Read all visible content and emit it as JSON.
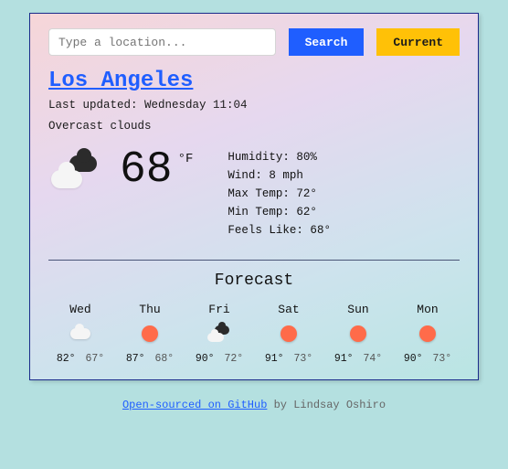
{
  "search": {
    "placeholder": "Type a location...",
    "search_label": "Search",
    "current_label": "Current"
  },
  "location": {
    "name": "Los Angeles",
    "last_updated": "Last updated: Wednesday 11:04",
    "condition": "Overcast clouds"
  },
  "current": {
    "temp": "68",
    "unit": "°F",
    "humidity": "Humidity: 80%",
    "wind": "Wind: 8 mph",
    "max": "Max Temp: 72°",
    "min": "Min Temp: 62°",
    "feels": "Feels Like: 68°",
    "icon": "overcast"
  },
  "forecast": {
    "title": "Forecast",
    "days": [
      {
        "name": "Wed",
        "icon": "cloud",
        "hi": "82°",
        "lo": "67°"
      },
      {
        "name": "Thu",
        "icon": "sun",
        "hi": "87°",
        "lo": "68°"
      },
      {
        "name": "Fri",
        "icon": "mix",
        "hi": "90°",
        "lo": "72°"
      },
      {
        "name": "Sat",
        "icon": "sun",
        "hi": "91°",
        "lo": "73°"
      },
      {
        "name": "Sun",
        "icon": "sun",
        "hi": "91°",
        "lo": "74°"
      },
      {
        "name": "Mon",
        "icon": "sun",
        "hi": "90°",
        "lo": "73°"
      }
    ]
  },
  "footer": {
    "link": "Open-sourced on GitHub",
    "by": " by Lindsay Oshiro"
  }
}
